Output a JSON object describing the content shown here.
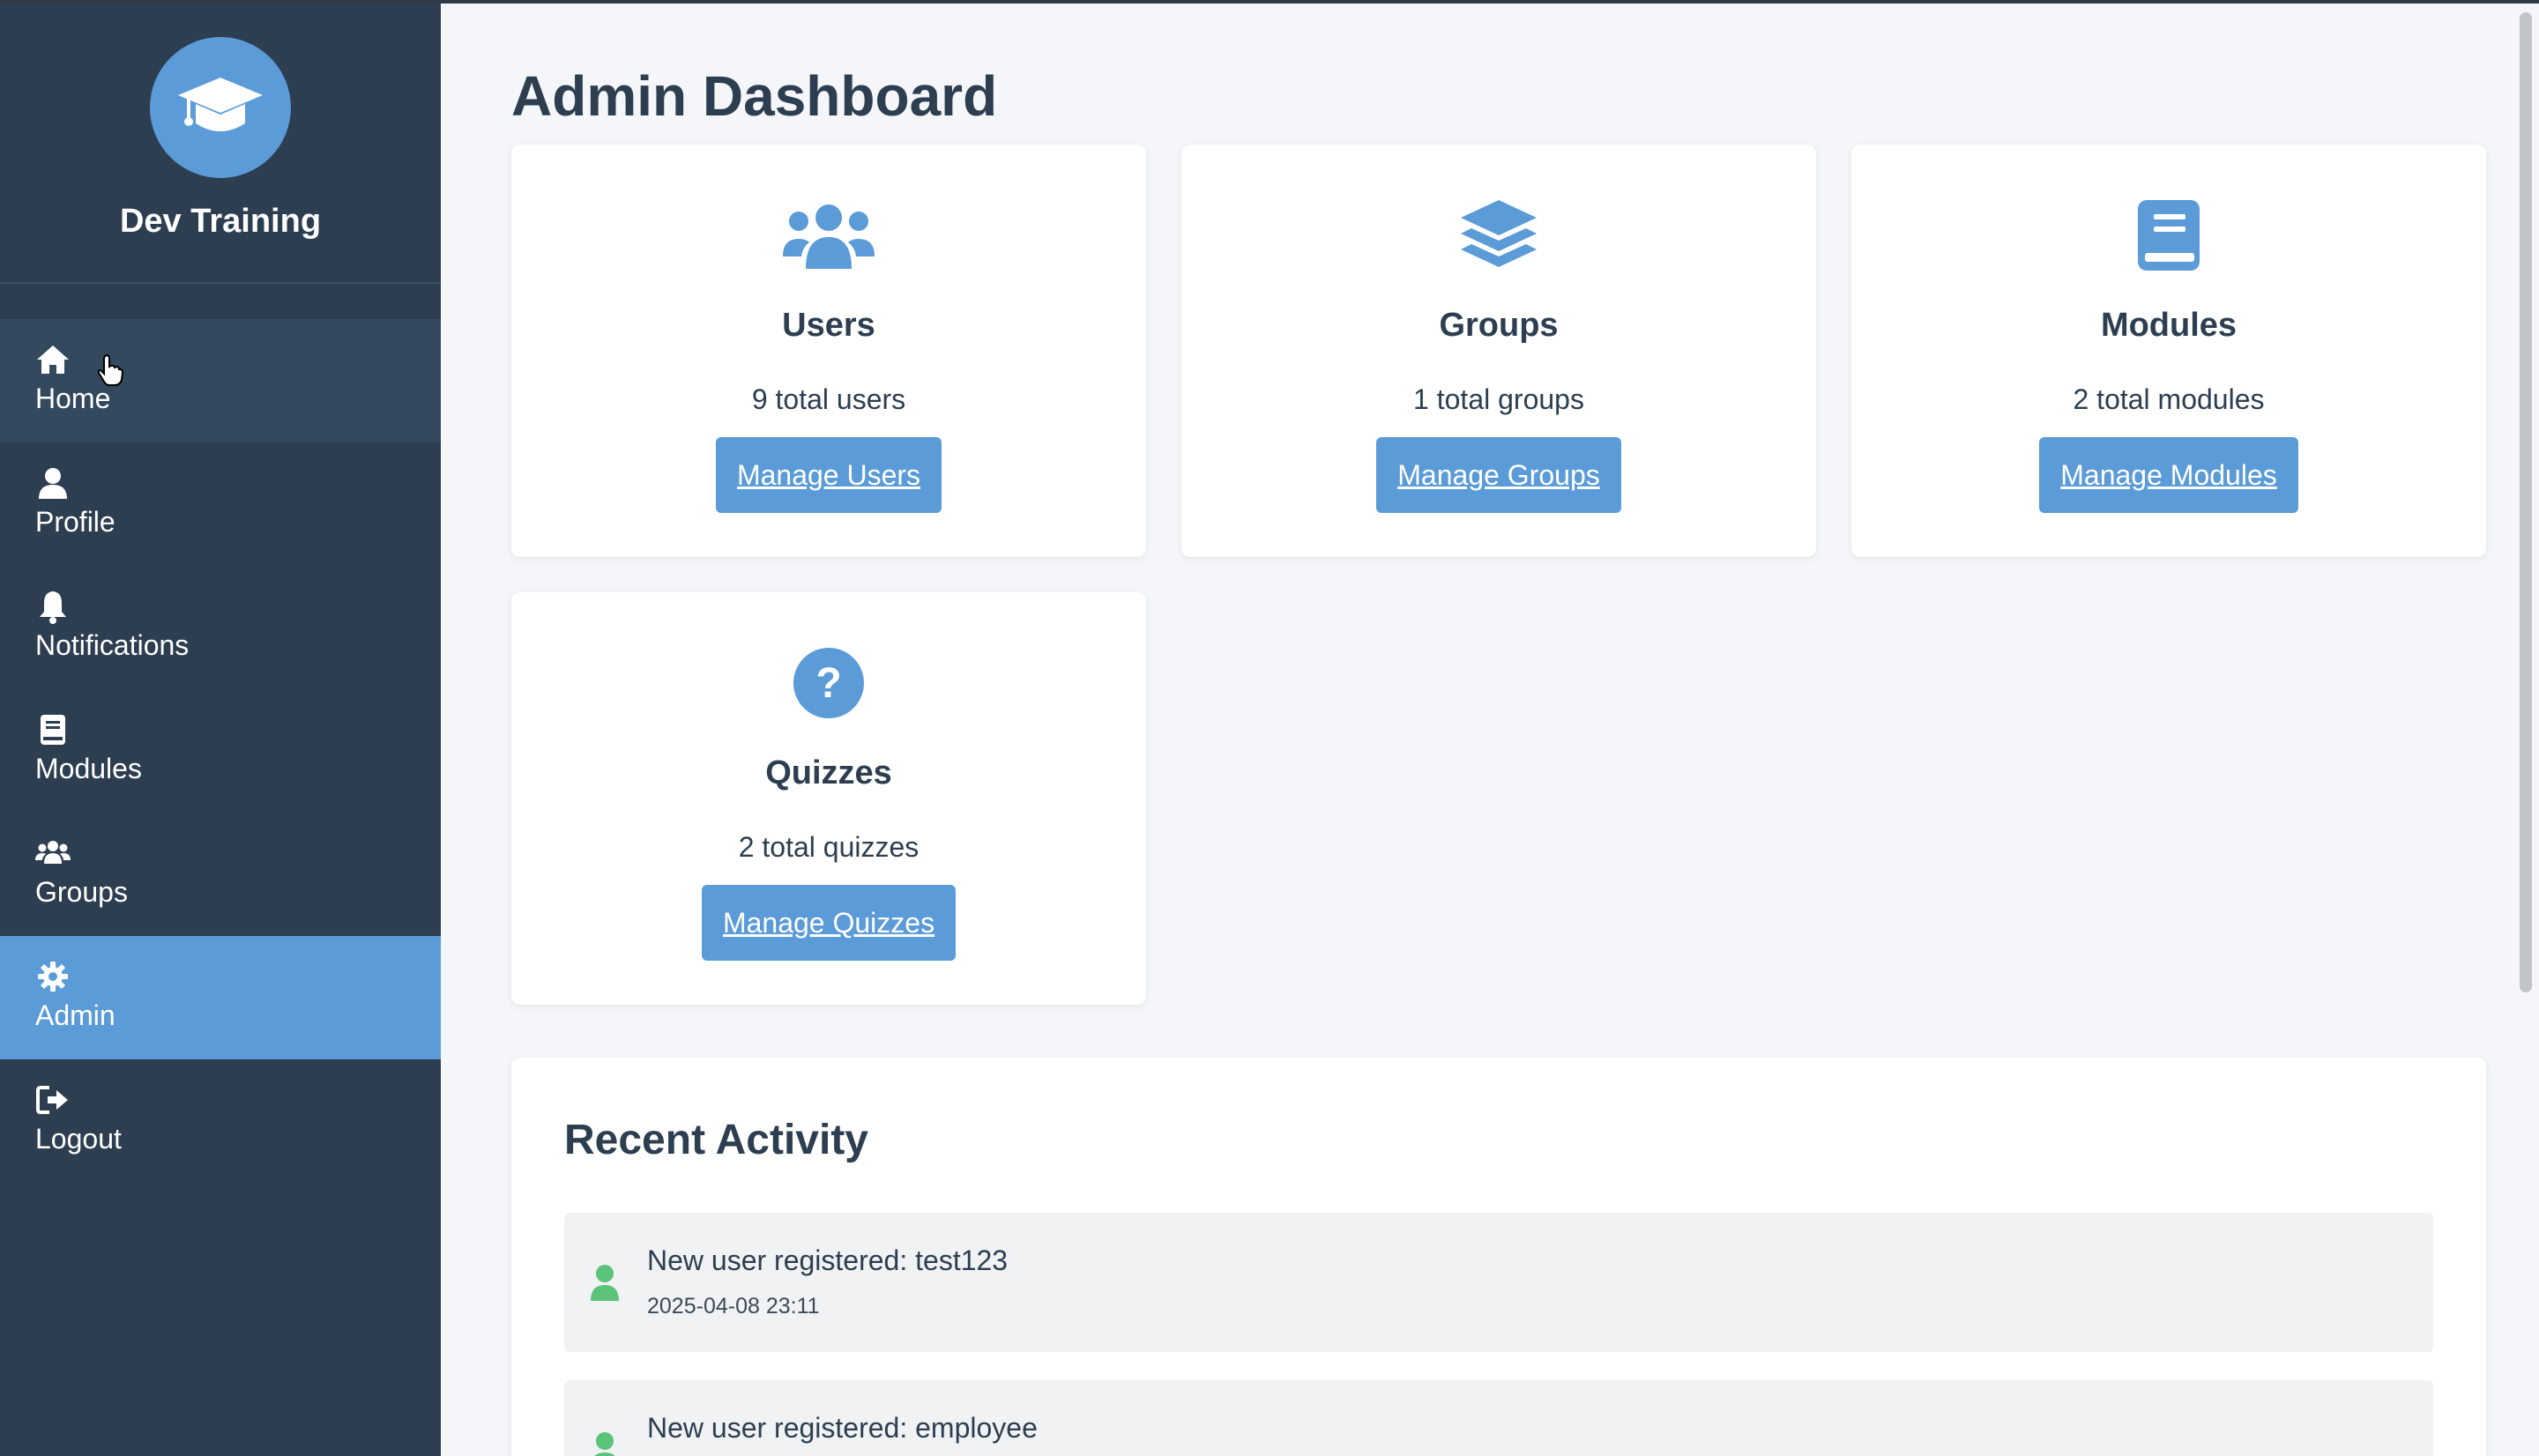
{
  "brand": {
    "title": "Dev Training",
    "icon": "graduation-cap-icon"
  },
  "nav": {
    "items": [
      {
        "label": "Home",
        "icon": "home-icon"
      },
      {
        "label": "Profile",
        "icon": "user-icon"
      },
      {
        "label": "Notifications",
        "icon": "bell-icon"
      },
      {
        "label": "Modules",
        "icon": "book-icon"
      },
      {
        "label": "Groups",
        "icon": "users-icon"
      },
      {
        "label": "Admin",
        "icon": "gear-icon",
        "active": true
      },
      {
        "label": "Logout",
        "icon": "logout-icon"
      }
    ]
  },
  "main": {
    "title": "Admin Dashboard",
    "cards": [
      {
        "title": "Users",
        "count": "9 total users",
        "button": "Manage Users",
        "icon": "users-icon"
      },
      {
        "title": "Groups",
        "count": "1 total groups",
        "button": "Manage Groups",
        "icon": "layers-icon"
      },
      {
        "title": "Modules",
        "count": "2 total modules",
        "button": "Manage Modules",
        "icon": "book-icon"
      },
      {
        "title": "Quizzes",
        "count": "2 total quizzes",
        "button": "Manage Quizzes",
        "icon": "question-circle-icon"
      }
    ],
    "activity": {
      "title": "Recent Activity",
      "items": [
        {
          "text": "New user registered: test123",
          "time": "2025-04-08 23:11"
        },
        {
          "text": "New user registered: employee",
          "time": ""
        }
      ]
    }
  },
  "colors": {
    "sidebar": "#2c3e50",
    "accent": "#5a9bd8",
    "success": "#5cc37a"
  }
}
